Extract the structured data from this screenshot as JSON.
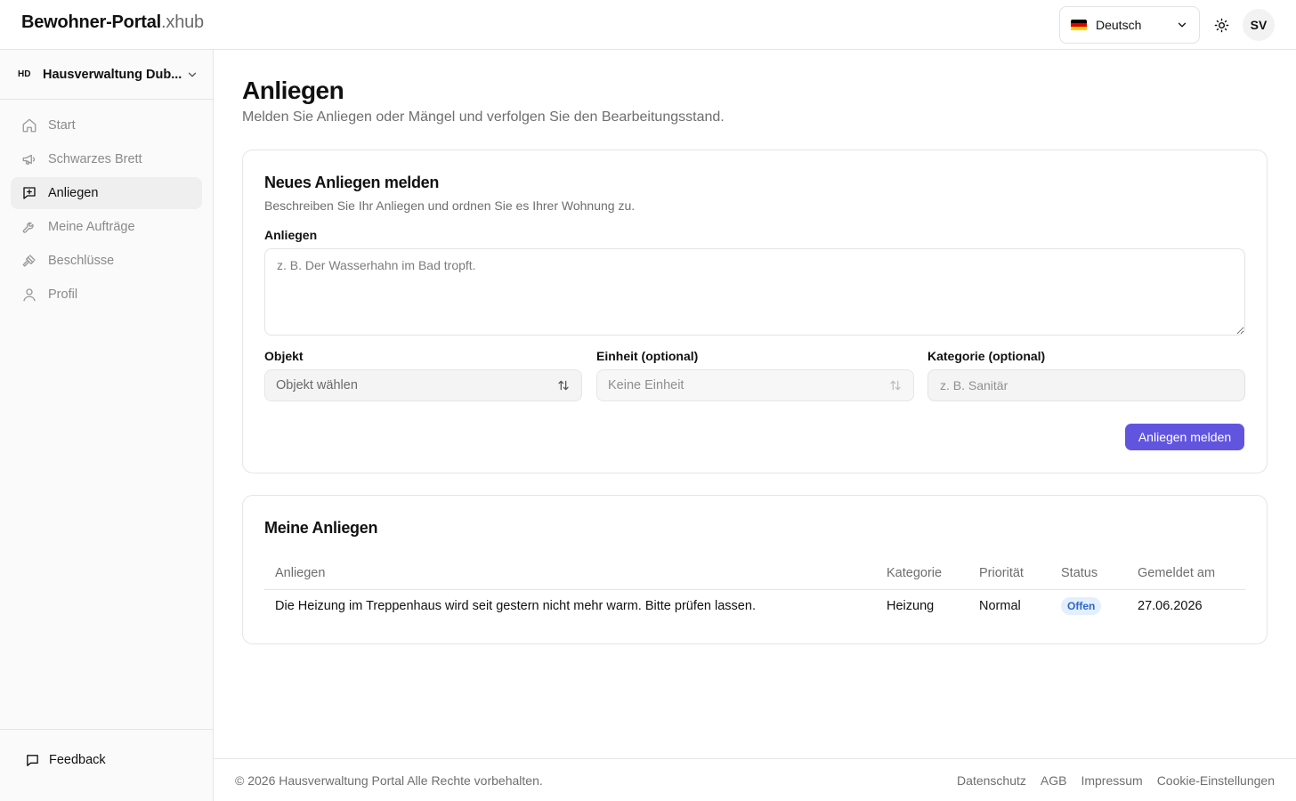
{
  "header": {
    "brand_bold": "Bewohner-Portal",
    "brand_light": ".xhub",
    "language": "Deutsch",
    "avatar_initials": "SV"
  },
  "sidebar": {
    "org_badge": "HD",
    "org_name": "Hausverwaltung Dub...",
    "items": [
      {
        "label": "Start",
        "icon": "home-icon"
      },
      {
        "label": "Schwarzes Brett",
        "icon": "megaphone-icon"
      },
      {
        "label": "Anliegen",
        "icon": "message-plus-icon",
        "active": true
      },
      {
        "label": "Meine Aufträge",
        "icon": "wrench-icon"
      },
      {
        "label": "Beschlüsse",
        "icon": "gavel-icon"
      },
      {
        "label": "Profil",
        "icon": "user-icon"
      }
    ],
    "feedback_label": "Feedback"
  },
  "page": {
    "title": "Anliegen",
    "subtitle": "Melden Sie Anliegen oder Mängel und verfolgen Sie den Bearbeitungsstand."
  },
  "new_request": {
    "title": "Neues Anliegen melden",
    "description": "Beschreiben Sie Ihr Anliegen und ordnen Sie es Ihrer Wohnung zu.",
    "request_label": "Anliegen",
    "request_placeholder": "z. B. Der Wasserhahn im Bad tropft.",
    "object_label": "Objekt",
    "object_value": "Objekt wählen",
    "unit_label": "Einheit (optional)",
    "unit_value": "Keine Einheit",
    "category_label": "Kategorie (optional)",
    "category_placeholder": "z. B. Sanitär",
    "submit_label": "Anliegen melden"
  },
  "my_requests": {
    "title": "Meine Anliegen",
    "columns": [
      "Anliegen",
      "Kategorie",
      "Priorität",
      "Status",
      "Gemeldet am"
    ],
    "rows": [
      {
        "request": "Die Heizung im Treppenhaus wird seit gestern nicht mehr warm. Bitte prüfen lassen.",
        "category": "Heizung",
        "priority": "Normal",
        "status": "Offen",
        "date": "27.06.2026"
      }
    ]
  },
  "footer": {
    "copyright": "© 2026 Hausverwaltung Portal Alle Rechte vorbehalten.",
    "links": [
      "Datenschutz",
      "AGB",
      "Impressum",
      "Cookie-Einstellungen"
    ]
  },
  "colors": {
    "accent": "#6155e0",
    "status_badge_bg": "#e3efff",
    "status_badge_text": "#2f66c8"
  }
}
